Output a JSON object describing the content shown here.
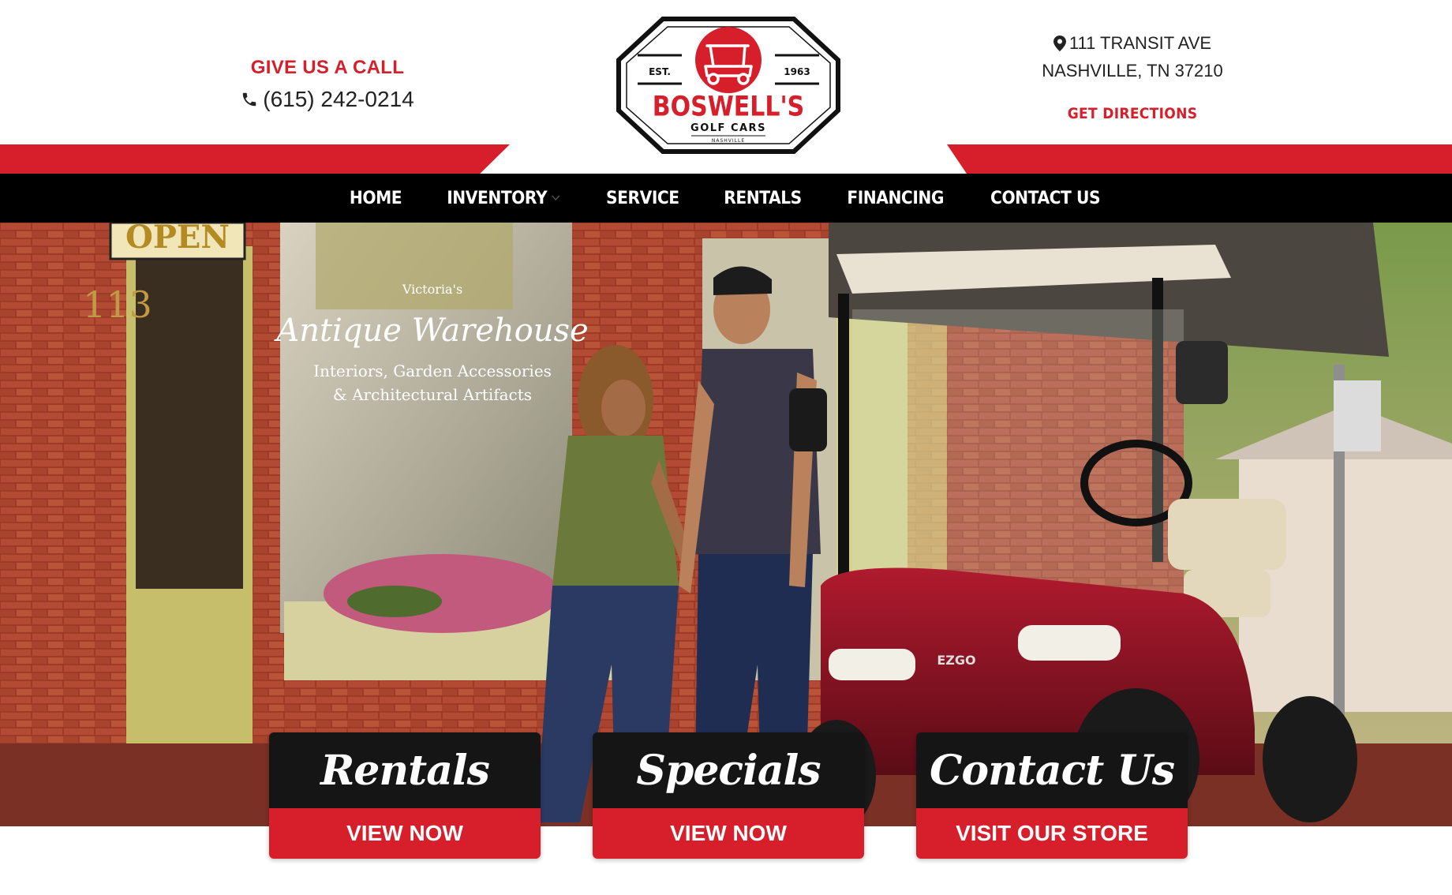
{
  "header": {
    "call": {
      "title": "GIVE US A CALL",
      "phone": "(615) 242-0214",
      "icon": "phone-icon"
    },
    "address": {
      "line1": "111 TRANSIT AVE",
      "line2": "NASHVILLE, TN 37210",
      "directions": "GET DIRECTIONS",
      "icon": "map-pin-icon"
    },
    "logo": {
      "est": "EST.",
      "year": "1963",
      "name": "BOSWELL'S",
      "sub": "GOLF CARS",
      "city": "NASHVILLE"
    }
  },
  "nav": {
    "items": [
      {
        "label": "HOME"
      },
      {
        "label": "INVENTORY",
        "has_dropdown": true
      },
      {
        "label": "SERVICE"
      },
      {
        "label": "RENTALS"
      },
      {
        "label": "FINANCING"
      },
      {
        "label": "CONTACT US"
      }
    ]
  },
  "hero": {
    "scene": "couple holding hands beside red golf cart in front of brick storefront",
    "sign": "OPEN",
    "window_text": [
      "Victoria's",
      "Antique Warehouse",
      "Interiors, Garden Accessories",
      "& Architectural Artifacts"
    ],
    "address_number": "113",
    "cart_brand": "EZGO"
  },
  "cards": [
    {
      "title": "Rentals",
      "button": "VIEW NOW"
    },
    {
      "title": "Specials",
      "button": "VIEW NOW"
    },
    {
      "title": "Contact Us",
      "button": "VISIT OUR STORE"
    }
  ],
  "colors": {
    "brand_red": "#d61f2b",
    "nav_bg": "#000000",
    "card_dark": "#151515"
  }
}
